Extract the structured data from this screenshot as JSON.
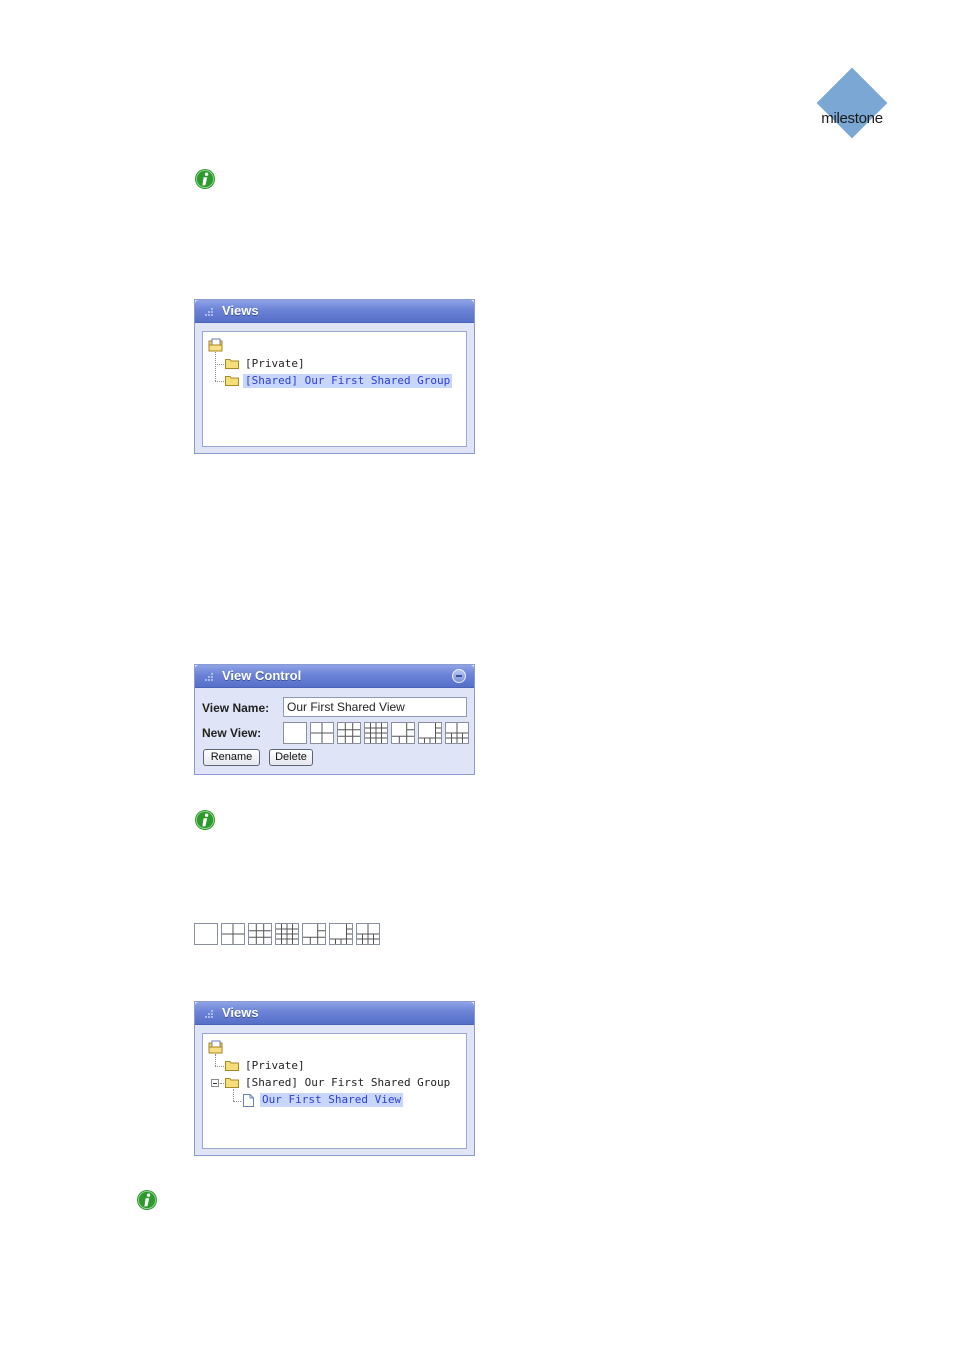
{
  "logo": {
    "text": "milestone",
    "color": "#7ba7d4"
  },
  "info_icon": {
    "name": "info-icon",
    "color": "#2e9a2e"
  },
  "views_panel_1": {
    "title": "Views",
    "items": [
      {
        "label": "[Private]",
        "selected": false
      },
      {
        "label": "[Shared] Our First Shared Group",
        "selected": true
      }
    ]
  },
  "view_control": {
    "title": "View Control",
    "view_name_label": "View Name:",
    "view_name_value": "Our First Shared View",
    "new_view_label": "New View:",
    "layouts": [
      "1x1",
      "2x2",
      "3x3",
      "4x4",
      "1+5",
      "1+7",
      "2+8"
    ],
    "rename_label": "Rename",
    "delete_label": "Delete"
  },
  "views_panel_2": {
    "title": "Views",
    "items": [
      {
        "label": "[Private]",
        "selected": false
      },
      {
        "label": "[Shared] Our First Shared Group",
        "selected": false
      },
      {
        "label": "Our First Shared View",
        "selected": true
      }
    ]
  }
}
